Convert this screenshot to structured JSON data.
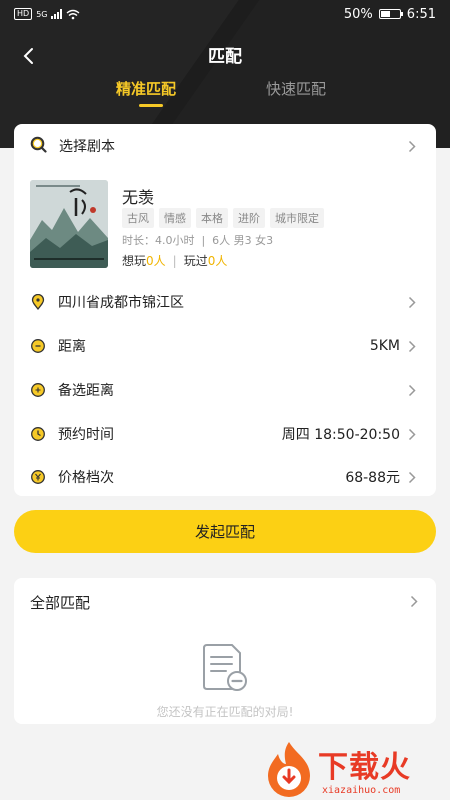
{
  "status_bar": {
    "network_badge": "HD",
    "network_type": "5G",
    "battery": "50%",
    "time": "6:51"
  },
  "nav": {
    "title": "匹配",
    "back_icon": "chevron-left-icon"
  },
  "tabs": [
    {
      "label": "精准匹配",
      "active": true
    },
    {
      "label": "快速匹配",
      "active": false
    }
  ],
  "search": {
    "label": "选择剧本",
    "icon": "search-icon"
  },
  "script": {
    "title": "无羡",
    "tags": [
      "古风",
      "情感",
      "本格",
      "进阶",
      "城市限定"
    ],
    "meta": "时长：4.0小时  |  6人 男3 女3",
    "want_label": "想玩",
    "want_count": "0人",
    "played_label": "玩过",
    "played_count": "0人"
  },
  "options": {
    "location": {
      "label": "四川省成都市锦江区",
      "value": ""
    },
    "distance": {
      "label": "距离",
      "value": "5KM"
    },
    "alt_distance": {
      "label": "备选距离",
      "value": ""
    },
    "time": {
      "label": "预约时间",
      "value": "周四 18:50-20:50"
    },
    "price": {
      "label": "价格档次",
      "value": "68-88元"
    }
  },
  "start_button": "发起匹配",
  "all_matches": {
    "title": "全部匹配",
    "empty_text": "您还没有正在匹配的对局!"
  },
  "watermark": {
    "text": "下载火",
    "sub": "xiazaihuo.com"
  },
  "colors": {
    "accent": "#fcd014",
    "tab_active": "#f6c927",
    "header_bg": "#1d1d1d",
    "highlight": "#f0b400"
  }
}
